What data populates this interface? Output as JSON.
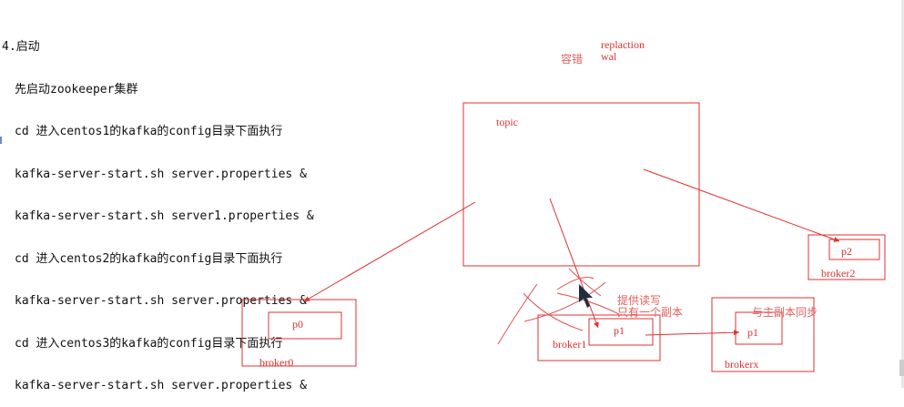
{
  "notes": {
    "heading": "4.启动",
    "lines": [
      "先启动zookeeper集群",
      "cd 进入centos1的kafka的config目录下面执行",
      "kafka-server-start.sh server.properties &",
      "kafka-server-start.sh server1.properties &",
      "cd 进入centos2的kafka的config目录下面执行",
      "kafka-server-start.sh server.properties &",
      "cd 进入centos3的kafka的config目录下面执行",
      "kafka-server-start.sh server.properties &"
    ]
  },
  "diagram": {
    "replication": "replaction",
    "wal": "wal",
    "fault_tolerance": "容错",
    "topic": "topic",
    "broker0": "broker0",
    "p0": "p0",
    "broker1": "broker1",
    "p1_leader": "p1",
    "broker2": "broker2",
    "p2": "p2",
    "brokerx": "brokerx",
    "p1_follower": "p1",
    "leader_note_1": "提供读写",
    "leader_note_2": "只有一个副本",
    "follower_note": "与主副本同步",
    "color": "#e03030"
  }
}
